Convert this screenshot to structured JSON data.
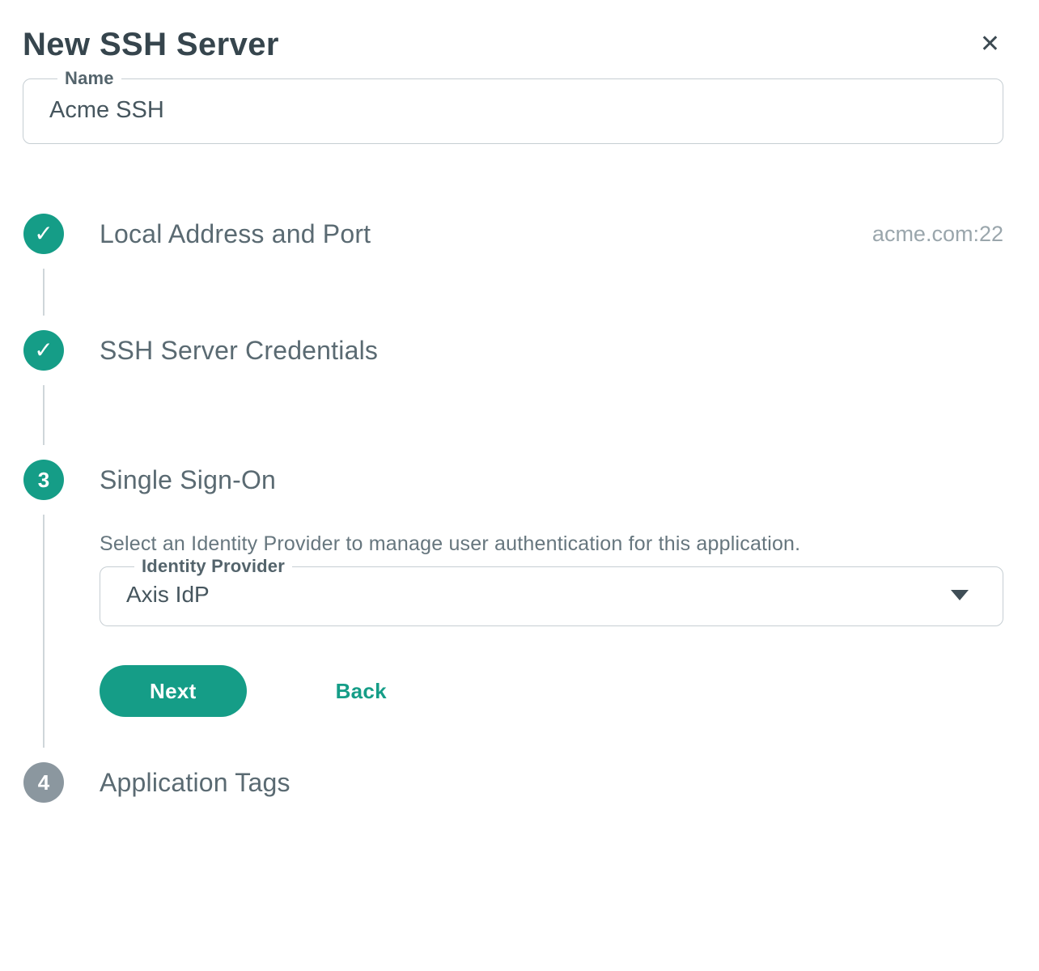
{
  "modal": {
    "title": "New SSH Server"
  },
  "icons": {
    "close": "✕",
    "check": "✓"
  },
  "name_field": {
    "label": "Name",
    "value": "Acme SSH"
  },
  "steps": [
    {
      "label": "Local Address and Port",
      "meta": "acme.com:22",
      "status": "complete"
    },
    {
      "label": "SSH Server Credentials",
      "status": "complete"
    },
    {
      "number": "3",
      "label": "Single Sign-On",
      "status": "active",
      "description": "Select an Identity Provider to manage user authentication for this application."
    },
    {
      "number": "4",
      "label": "Application Tags",
      "status": "upcoming"
    }
  ],
  "sso": {
    "idp_field": {
      "label": "Identity Provider",
      "value": "Axis IdP"
    },
    "next_label": "Next",
    "back_label": "Back"
  },
  "colors": {
    "accent": "#159d87",
    "inactive_step": "#8b979f",
    "border": "#c6ced3",
    "connector": "#cfd6da"
  }
}
